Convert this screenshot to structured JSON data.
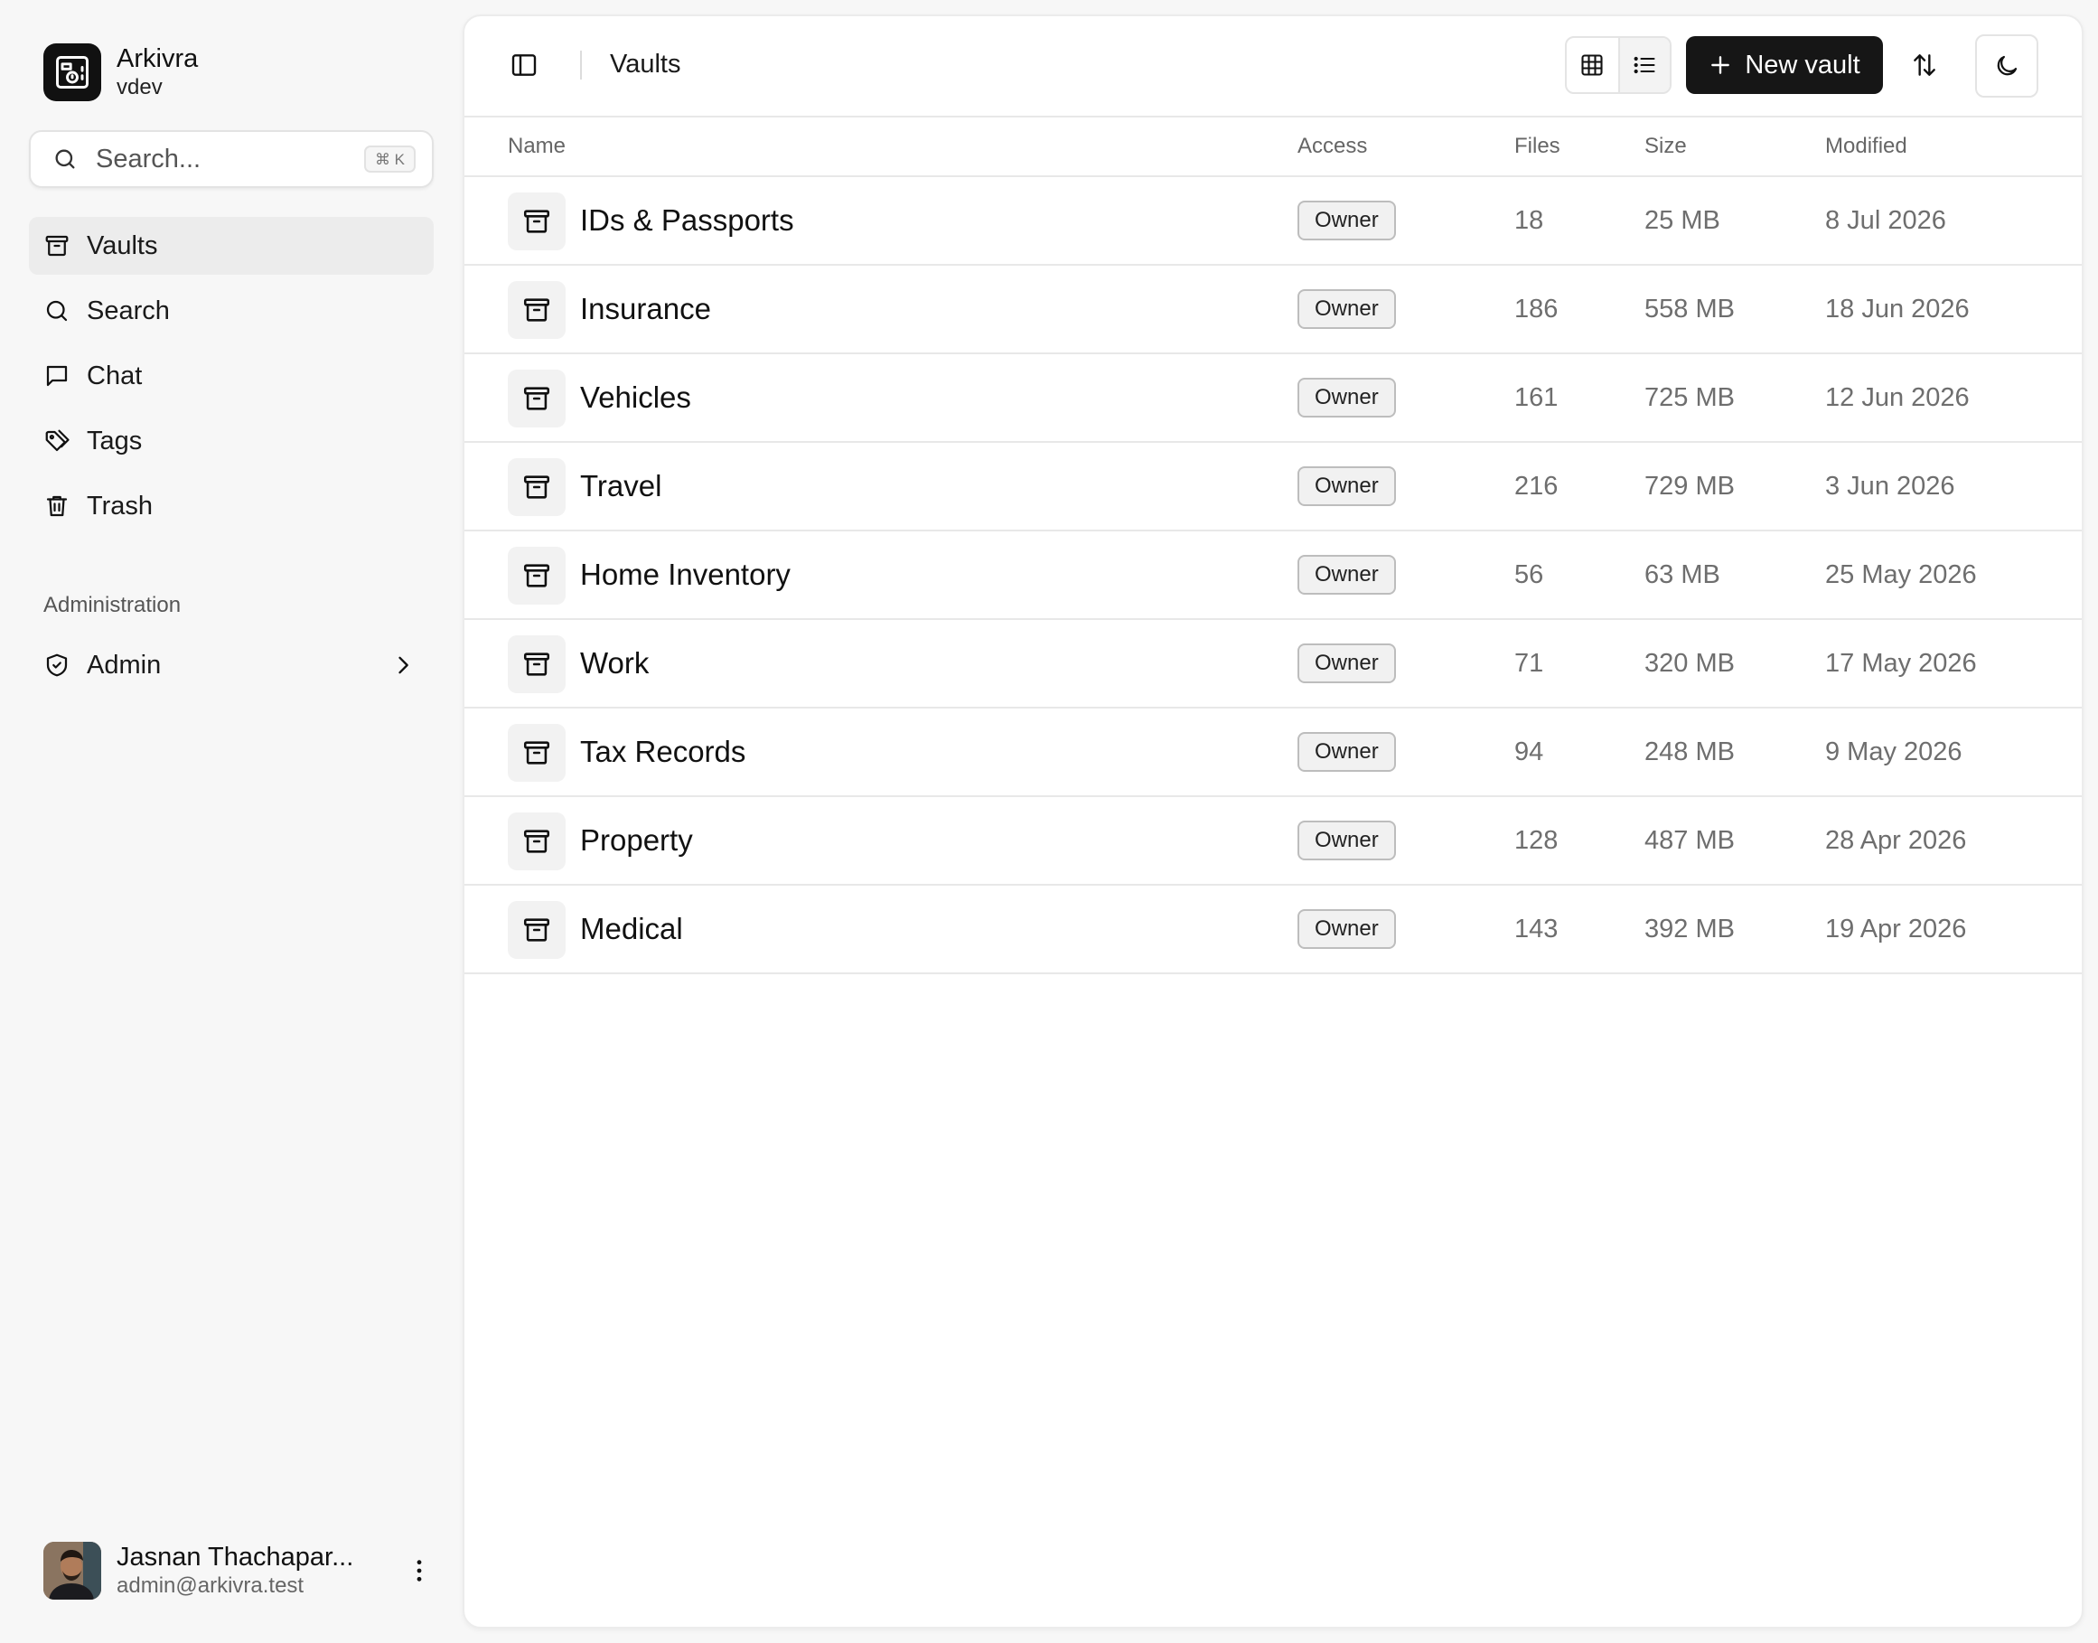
{
  "brand": {
    "name": "Arkivra",
    "workspace": "vdev"
  },
  "search": {
    "placeholder": "Search...",
    "shortcut": "⌘ K"
  },
  "nav": {
    "items": [
      {
        "label": "Vaults",
        "icon": "archive-icon",
        "active": true
      },
      {
        "label": "Search",
        "icon": "search-icon",
        "active": false
      },
      {
        "label": "Chat",
        "icon": "chat-icon",
        "active": false
      },
      {
        "label": "Tags",
        "icon": "tags-icon",
        "active": false
      },
      {
        "label": "Trash",
        "icon": "trash-icon",
        "active": false
      }
    ],
    "section_label": "Administration",
    "admin_label": "Admin"
  },
  "user": {
    "name": "Jasnan Thachapar...",
    "email": "admin@arkivra.test"
  },
  "header": {
    "breadcrumb": "Vaults",
    "new_vault_label": "New vault"
  },
  "table": {
    "columns": {
      "name": "Name",
      "access": "Access",
      "files": "Files",
      "size": "Size",
      "modified": "Modified"
    },
    "rows": [
      {
        "name": "IDs & Passports",
        "access": "Owner",
        "files": "18",
        "size": "25 MB",
        "modified": "8 Jul 2026"
      },
      {
        "name": "Insurance",
        "access": "Owner",
        "files": "186",
        "size": "558 MB",
        "modified": "18 Jun 2026"
      },
      {
        "name": "Vehicles",
        "access": "Owner",
        "files": "161",
        "size": "725 MB",
        "modified": "12 Jun 2026"
      },
      {
        "name": "Travel",
        "access": "Owner",
        "files": "216",
        "size": "729 MB",
        "modified": "3 Jun 2026"
      },
      {
        "name": "Home Inventory",
        "access": "Owner",
        "files": "56",
        "size": "63 MB",
        "modified": "25 May 2026"
      },
      {
        "name": "Work",
        "access": "Owner",
        "files": "71",
        "size": "320 MB",
        "modified": "17 May 2026"
      },
      {
        "name": "Tax Records",
        "access": "Owner",
        "files": "94",
        "size": "248 MB",
        "modified": "9 May 2026"
      },
      {
        "name": "Property",
        "access": "Owner",
        "files": "128",
        "size": "487 MB",
        "modified": "28 Apr 2026"
      },
      {
        "name": "Medical",
        "access": "Owner",
        "files": "143",
        "size": "392 MB",
        "modified": "19 Apr 2026"
      }
    ]
  }
}
